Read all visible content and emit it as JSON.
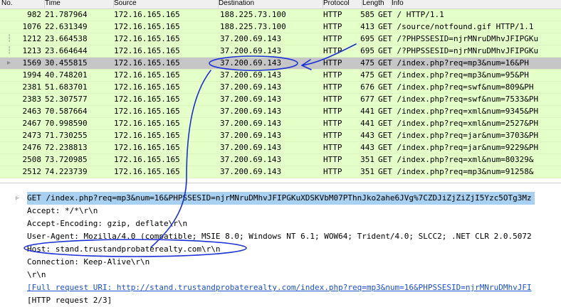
{
  "header": {
    "no": "No.",
    "time": "Time",
    "source": "Source",
    "destination": "Destination",
    "protocol": "Protocol",
    "length": "Length",
    "info": "Info"
  },
  "packets": [
    {
      "no": "982",
      "time": "21.787964",
      "src": "172.16.165.165",
      "dst": "188.225.73.100",
      "proto": "HTTP",
      "len": "585",
      "info": "GET / HTTP/1.1"
    },
    {
      "no": "1076",
      "time": "22.631349",
      "src": "172.16.165.165",
      "dst": "188.225.73.100",
      "proto": "HTTP",
      "len": "413",
      "info": "GET /source/notfound.gif HTTP/1.1"
    },
    {
      "no": "1212",
      "time": "23.664538",
      "src": "172.16.165.165",
      "dst": "37.200.69.143",
      "proto": "HTTP",
      "len": "695",
      "info": "GET /?PHPSSESID=njrMNruDMhvJFIPGKu"
    },
    {
      "no": "1213",
      "time": "23.664644",
      "src": "172.16.165.165",
      "dst": "37.200.69.143",
      "proto": "HTTP",
      "len": "695",
      "info": "GET /?PHPSSESID=njrMNruDMhvJFIPGKu"
    },
    {
      "no": "1569",
      "time": "30.455815",
      "src": "172.16.165.165",
      "dst": "37.200.69.143",
      "proto": "HTTP",
      "len": "475",
      "info": "GET /index.php?req=mp3&num=16&PH"
    },
    {
      "no": "1994",
      "time": "40.748201",
      "src": "172.16.165.165",
      "dst": "37.200.69.143",
      "proto": "HTTP",
      "len": "475",
      "info": "GET /index.php?req=mp3&num=95&PH"
    },
    {
      "no": "2381",
      "time": "51.683701",
      "src": "172.16.165.165",
      "dst": "37.200.69.143",
      "proto": "HTTP",
      "len": "676",
      "info": "GET /index.php?req=swf&num=809&PH"
    },
    {
      "no": "2383",
      "time": "52.307577",
      "src": "172.16.165.165",
      "dst": "37.200.69.143",
      "proto": "HTTP",
      "len": "677",
      "info": "GET /index.php?req=swf&num=7533&PH"
    },
    {
      "no": "2463",
      "time": "70.587664",
      "src": "172.16.165.165",
      "dst": "37.200.69.143",
      "proto": "HTTP",
      "len": "441",
      "info": "GET /index.php?req=xml&num=9345&PH"
    },
    {
      "no": "2467",
      "time": "70.998590",
      "src": "172.16.165.165",
      "dst": "37.200.69.143",
      "proto": "HTTP",
      "len": "441",
      "info": "GET /index.php?req=xml&num=2527&PH"
    },
    {
      "no": "2473",
      "time": "71.730255",
      "src": "172.16.165.165",
      "dst": "37.200.69.143",
      "proto": "HTTP",
      "len": "443",
      "info": "GET /index.php?req=jar&num=3703&PH"
    },
    {
      "no": "2476",
      "time": "72.238813",
      "src": "172.16.165.165",
      "dst": "37.200.69.143",
      "proto": "HTTP",
      "len": "443",
      "info": "GET /index.php?req=jar&num=9229&PH"
    },
    {
      "no": "2508",
      "time": "73.720985",
      "src": "172.16.165.165",
      "dst": "37.200.69.143",
      "proto": "HTTP",
      "len": "351",
      "info": "GET /index.php?req=xml&num=80329&"
    },
    {
      "no": "2512",
      "time": "74.223739",
      "src": "172.16.165.165",
      "dst": "37.200.69.143",
      "proto": "HTTP",
      "len": "351",
      "info": "GET /index.php?req=mp3&num=91258&"
    }
  ],
  "details": [
    "GET /index.php?req=mp3&num=16&PHPSSESID=njrMNruDMhvJFIPGKuXDSKVbM07PThnJko2ahe6JVg%7CZDJiZjZiZjI5Yzc5OTg3Mz",
    "Accept: */*\\r\\n",
    "Accept-Encoding: gzip, deflate\\r\\n",
    "User-Agent: Mozilla/4.0 (compatible; MSIE 8.0; Windows NT 6.1; WOW64; Trident/4.0; SLCC2; .NET CLR 2.0.5072",
    "Host: stand.trustandprobaterealty.com\\r\\n",
    "Connection: Keep-Alive\\r\\n",
    "\\r\\n",
    "[Full request URI: http://stand.trustandprobaterealty.com/index.php?req=mp3&num=16&PHPSSESID=njrMNruDMhvJFI",
    "[HTTP request 2/3]"
  ],
  "colors": {
    "http_row": "#e4ffc7",
    "selected_row": "#c6c6c6",
    "annotation": "#1a2fd6",
    "detail_highlight": "#a8d0f0"
  }
}
